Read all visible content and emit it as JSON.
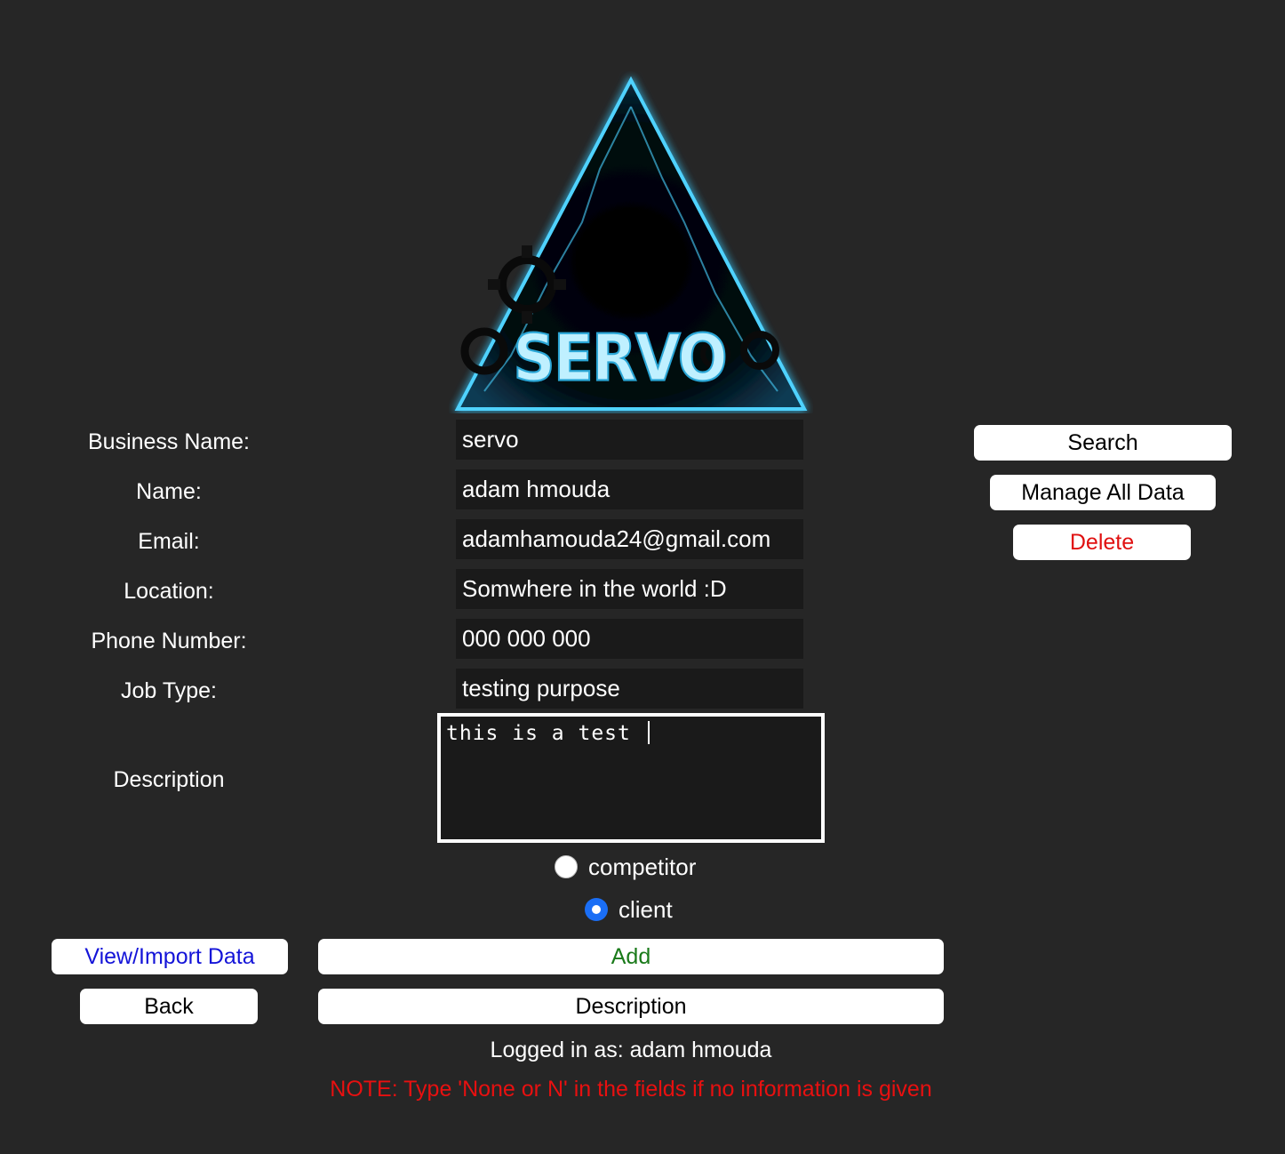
{
  "logo": {
    "wordmark": "SERVO"
  },
  "form": {
    "labels": {
      "business_name": "Business Name:",
      "name": "Name:",
      "email": "Email:",
      "location": "Location:",
      "phone": "Phone Number:",
      "job_type": "Job Type:",
      "description": "Description"
    },
    "values": {
      "business_name": "servo",
      "name": "adam hmouda",
      "email": "adamhamouda24@gmail.com",
      "location": "Somwhere in the world :D",
      "phone": "000 000 000",
      "job_type": "testing purpose",
      "description": "this is a test "
    },
    "type_options": [
      {
        "label": "competitor",
        "selected": false
      },
      {
        "label": "client",
        "selected": true
      }
    ]
  },
  "side_buttons": {
    "search": "Search",
    "manage_all": "Manage All Data",
    "delete": "Delete"
  },
  "bottom_buttons": {
    "view_import": "View/Import Data",
    "add": "Add",
    "back": "Back",
    "description": "Description"
  },
  "status": {
    "logged_in": "Logged in as: adam hmouda",
    "note": "NOTE: Type 'None or N' in the fields if no information is given"
  },
  "colors": {
    "background": "#262626",
    "field_bg": "#1a1a1a",
    "delete_text": "#e01010",
    "view_import_text": "#1414d8",
    "add_text": "#1a7a1a",
    "note_text": "#e81010",
    "radio_selected": "#1a6ef5",
    "logo_glow": "#3fc4f0"
  }
}
